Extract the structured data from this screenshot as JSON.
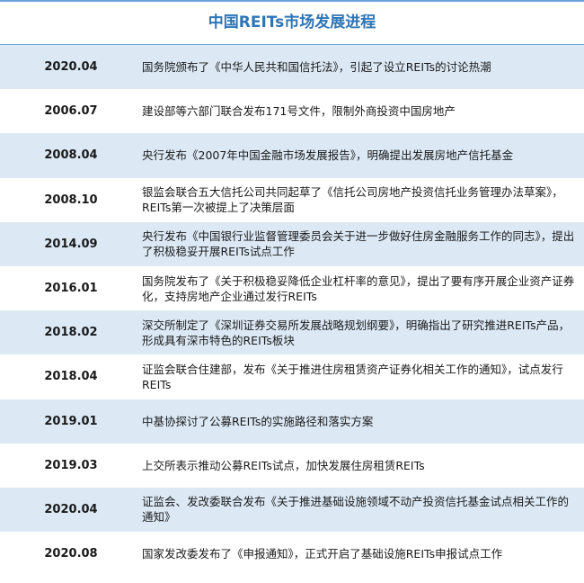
{
  "title": "中国REITs市场发展进程",
  "rows": [
    {
      "date": "2020.04",
      "event": "国务院颁布了《中华人民共和国信托法》，引起了设立REITs的讨论热潮"
    },
    {
      "date": "2006.07",
      "event": "建设部等六部门联合发布171号文件，限制外商投资中国房地产"
    },
    {
      "date": "2008.04",
      "event": "央行发布《2007年中国金融市场发展报告》，明确提出发展房地产信托基金"
    },
    {
      "date": "2008.10",
      "event": "银监会联合五大信托公司共同起草了《信托公司房地产投资信托业务管理办法草案》，REITs第一次被提上了决策层面"
    },
    {
      "date": "2014.09",
      "event": "央行发布《中国银行业监督管理委员会关于进一步做好住房金融服务工作的同志》，提出了积极稳妥开展REITs试点工作"
    },
    {
      "date": "2016.01",
      "event": "国务院发布了《关于积极稳妥降低企业杠杆率的意见》，提出了要有序开展企业资产证券化，支持房地产企业通过发行REITs"
    },
    {
      "date": "2018.02",
      "event": "深交所制定了《深圳证券交易所发展战略规划纲要》，明确指出了研究推进REITs产品，形成具有深市特色的REITs板块"
    },
    {
      "date": "2018.04",
      "event": "证监会联合住建部，发布《关于推进住房租赁资产证券化相关工作的通知》，试点发行REITs"
    },
    {
      "date": "2019.01",
      "event": "中基协探讨了公募REITs的实施路径和落实方案"
    },
    {
      "date": "2019.03",
      "event": "上交所表示推动公募REITs试点，加快发展住房租赁REITs"
    },
    {
      "date": "2020.04",
      "event": "证监会、发改委联合发布《关于推进基础设施领域不动产投资信托基金试点相关工作的通知》"
    },
    {
      "date": "2020.08",
      "event": "国家发改委发布了《申报通知》，正式开启了基础设施REITs申报试点工作"
    }
  ]
}
